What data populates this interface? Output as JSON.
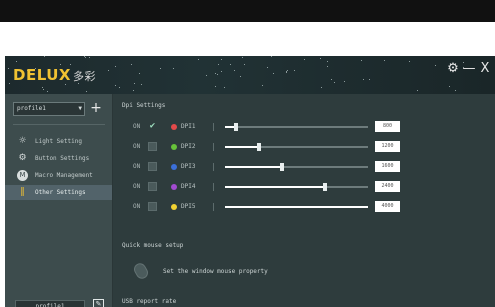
{
  "app": {
    "brand": "DELUX",
    "brand_cn": "多彩",
    "controls": {
      "settings": "⚙",
      "minimize": "—",
      "close": "X"
    }
  },
  "sidebar": {
    "profile_select": "profile1",
    "add_label": "+",
    "nav": [
      {
        "label": "Light Setting",
        "icon": "sun-icon",
        "active": false
      },
      {
        "label": "Button Settings",
        "icon": "gear-icon",
        "active": false
      },
      {
        "label": "Macro Management",
        "icon": "m-badge-icon",
        "active": false
      },
      {
        "label": "Other Settings",
        "icon": "sliders-icon",
        "active": true
      }
    ],
    "profile_name": "profile1"
  },
  "main": {
    "dpi_title": "Dpi Settings",
    "dpi_rows": [
      {
        "on_label": "ON",
        "checked": true,
        "color": "#e34a4a",
        "label": "DPI1",
        "value": "800",
        "level": 0.08
      },
      {
        "on_label": "ON",
        "checked": false,
        "color": "#67c23a",
        "label": "DPI2",
        "value": "1200",
        "level": 0.24
      },
      {
        "on_label": "ON",
        "checked": false,
        "color": "#3b6fd9",
        "label": "DPI3",
        "value": "1600",
        "level": 0.4
      },
      {
        "on_label": "ON",
        "checked": false,
        "color": "#a24bd1",
        "label": "DPI4",
        "value": "2400",
        "level": 0.7
      },
      {
        "on_label": "ON",
        "checked": false,
        "color": "#f1d232",
        "label": "DPI5",
        "value": "4000",
        "level": 1.0
      }
    ],
    "quick_title": "Quick mouse setup",
    "quick_text": "Set the window mouse property",
    "usb_title": "USB report rate"
  }
}
